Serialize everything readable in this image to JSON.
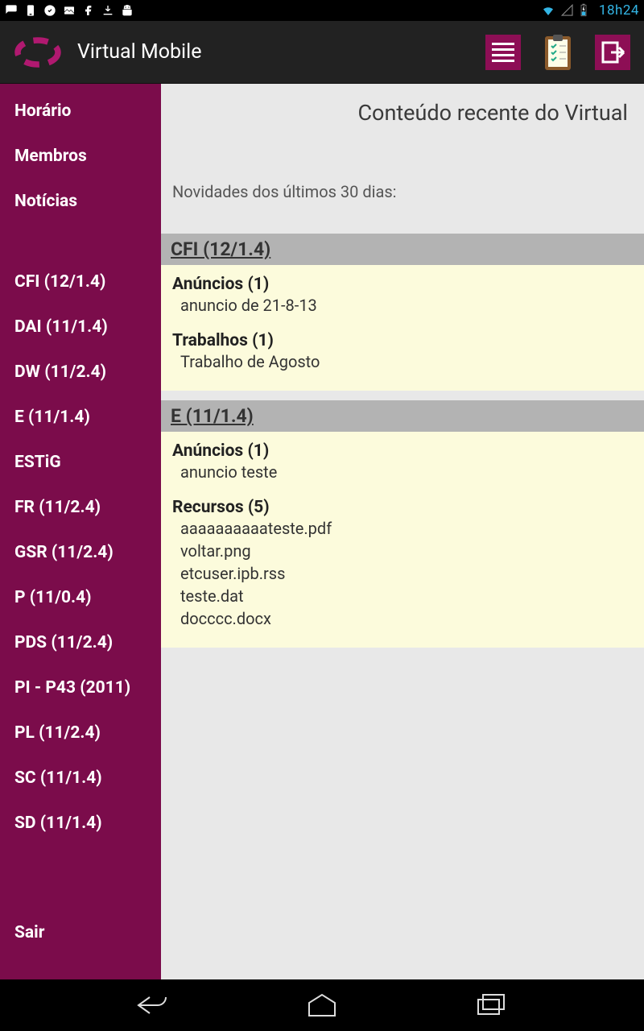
{
  "status": {
    "time": "18h24"
  },
  "actionbar": {
    "title": "Virtual Mobile"
  },
  "sidebar": {
    "top": [
      {
        "label": "Horário"
      },
      {
        "label": "Membros"
      },
      {
        "label": "Notícias"
      }
    ],
    "courses": [
      {
        "label": "CFI (12/1.4)"
      },
      {
        "label": "DAI (11/1.4)"
      },
      {
        "label": "DW (11/2.4)"
      },
      {
        "label": "E (11/1.4)"
      },
      {
        "label": "ESTiG"
      },
      {
        "label": "FR (11/2.4)"
      },
      {
        "label": "GSR (11/2.4)"
      },
      {
        "label": "P (11/0.4)"
      },
      {
        "label": "PDS (11/2.4)"
      },
      {
        "label": "PI - P43 (2011)"
      },
      {
        "label": "PL (11/2.4)"
      },
      {
        "label": "SC (11/1.4)"
      },
      {
        "label": "SD (11/1.4)"
      }
    ],
    "exit": "Sair"
  },
  "main": {
    "title": "Conteúdo recente do Virtual",
    "subtitle": "Novidades dos últimos 30 dias:",
    "sections": [
      {
        "header": "CFI (12/1.4)",
        "groups": [
          {
            "title": "Anúncios (1)",
            "items": [
              "anuncio de 21-8-13"
            ]
          },
          {
            "title": "Trabalhos (1)",
            "items": [
              "Trabalho de Agosto"
            ]
          }
        ]
      },
      {
        "header": "E (11/1.4)",
        "groups": [
          {
            "title": "Anúncios (1)",
            "items": [
              "anuncio teste"
            ]
          },
          {
            "title": "Recursos (5)",
            "items": [
              "aaaaaaaaaateste.pdf",
              "voltar.png",
              "etcuser.ipb.rss",
              "teste.dat",
              "docccc.docx"
            ]
          }
        ]
      }
    ]
  }
}
